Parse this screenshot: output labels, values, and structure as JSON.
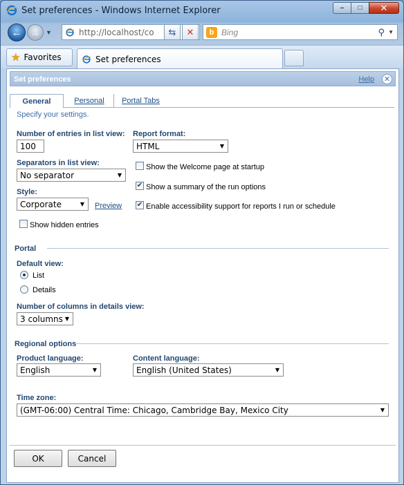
{
  "window": {
    "title": "Set preferences - Windows Internet Explorer",
    "minimize": "–",
    "maximize": "□",
    "close": "✕"
  },
  "nav": {
    "address": "http://localhost/co",
    "search_placeholder": "Bing",
    "bing_logo_text": "b"
  },
  "favorites": {
    "label": "Favorites"
  },
  "tab": {
    "label": "Set preferences"
  },
  "pane": {
    "title": "Set preferences",
    "help": "Help",
    "close_glyph": "✕"
  },
  "tabs": [
    {
      "label": "General",
      "active": true
    },
    {
      "label": "Personal",
      "active": false
    },
    {
      "label": "Portal Tabs",
      "active": false
    }
  ],
  "hint": "Specify your settings.",
  "general": {
    "entries_label": "Number of entries in list view:",
    "entries_value": "100",
    "report_format_label": "Report format:",
    "report_format_value": "HTML",
    "separators_label": "Separators in list view:",
    "separators_value": "No separator",
    "style_label": "Style:",
    "style_value": "Corporate",
    "preview_link": "Preview",
    "show_hidden_label": "Show hidden entries",
    "show_hidden_checked": false,
    "welcome_label": "Show the Welcome page at startup",
    "welcome_checked": false,
    "summary_label": "Show a summary of the run options",
    "summary_checked": true,
    "accessibility_label": "Enable accessibility support for reports I run or schedule",
    "accessibility_checked": true
  },
  "portal": {
    "section_label": "Portal",
    "default_view_label": "Default view:",
    "view_list": "List",
    "view_details": "Details",
    "selected_view": "List",
    "columns_label": "Number of columns in details view:",
    "columns_value": "3 columns"
  },
  "regional": {
    "section_label": "Regional options",
    "product_language_label": "Product language:",
    "product_language_value": "English",
    "content_language_label": "Content language:",
    "content_language_value": "English (United States)",
    "timezone_label": "Time zone:",
    "timezone_value": "(GMT-06:00) Central Time: Chicago, Cambridge Bay, Mexico City"
  },
  "buttons": {
    "ok": "OK",
    "cancel": "Cancel"
  },
  "icons": {
    "check": "✔",
    "dropdown": "▼",
    "star": "★",
    "back_arrow": "←",
    "forward_arrow": "→",
    "refresh": "⇆",
    "stop": "✕",
    "search": "⚲"
  },
  "colors": {
    "accent": "#22476f",
    "link": "#1c4d8a",
    "pane_header": "#a7bfdc",
    "close_button": "#c7452c"
  }
}
